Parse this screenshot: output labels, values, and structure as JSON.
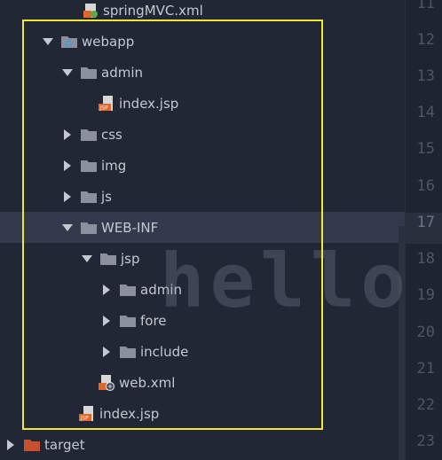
{
  "tree": {
    "items": [
      {
        "label": "springMVC.xml",
        "type": "xml-file",
        "icon": "xml-file-icon"
      },
      {
        "label": "webapp",
        "type": "webapp-folder",
        "expanded": true,
        "icon": "webapp-folder-icon"
      },
      {
        "label": "admin",
        "type": "folder",
        "expanded": true,
        "icon": "folder-icon"
      },
      {
        "label": "index.jsp",
        "type": "jsp-file",
        "icon": "jsp-file-icon"
      },
      {
        "label": "css",
        "type": "folder",
        "expanded": false,
        "icon": "folder-icon"
      },
      {
        "label": "img",
        "type": "folder",
        "expanded": false,
        "icon": "folder-icon"
      },
      {
        "label": "js",
        "type": "folder",
        "expanded": false,
        "icon": "folder-icon"
      },
      {
        "label": "WEB-INF",
        "type": "folder",
        "expanded": true,
        "selected": true,
        "icon": "folder-icon"
      },
      {
        "label": "jsp",
        "type": "folder",
        "expanded": true,
        "icon": "folder-icon"
      },
      {
        "label": "admin",
        "type": "folder",
        "expanded": false,
        "icon": "folder-icon"
      },
      {
        "label": "fore",
        "type": "folder",
        "expanded": false,
        "icon": "folder-icon"
      },
      {
        "label": "include",
        "type": "folder",
        "expanded": false,
        "icon": "folder-icon"
      },
      {
        "label": "web.xml",
        "type": "web-xml-file",
        "icon": "web-xml-icon"
      },
      {
        "label": "index.jsp",
        "type": "jsp-file",
        "icon": "jsp-file-icon"
      },
      {
        "label": "target",
        "type": "excluded-folder",
        "expanded": false,
        "icon": "target-folder-icon"
      }
    ]
  },
  "gutter": {
    "line_numbers": [
      "11",
      "12",
      "13",
      "14",
      "15",
      "16",
      "17",
      "18",
      "19",
      "20",
      "21",
      "22",
      "23"
    ],
    "current_line": "17"
  },
  "editor": {
    "watermark_text": "hello u"
  },
  "colors": {
    "highlight_box": "#f2e63a",
    "folder": "#8c909c",
    "target_folder": "#c8502e",
    "selection": "#343a4b"
  }
}
